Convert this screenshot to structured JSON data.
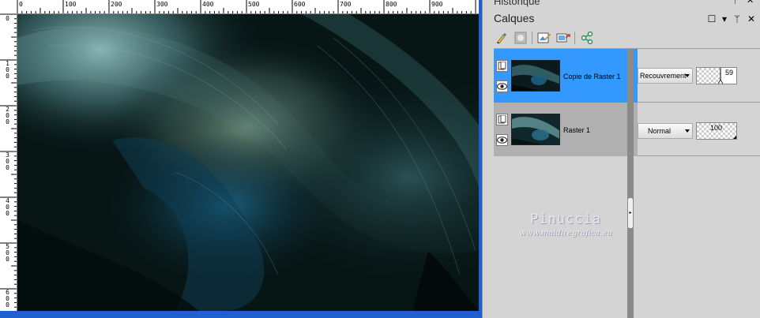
{
  "ruler": {
    "horizontal_labels": [
      "0",
      "100",
      "200",
      "300",
      "400",
      "500",
      "600",
      "700",
      "800",
      "900"
    ],
    "vertical_labels": [
      "0",
      "1\n0\n0",
      "2\n0\n0",
      "3\n0\n0",
      "4\n0\n0",
      "5\n0\n0",
      "6\n0\n0"
    ]
  },
  "history_panel": {
    "title": "Historique",
    "close_label": "✕",
    "pin_label": "ᛘ"
  },
  "layers_panel": {
    "title": "Calques",
    "controls": {
      "maximize": "☐",
      "menu": "▾",
      "pin": "ᛘ",
      "close": "✕"
    },
    "toolbar_icons": [
      "paint-brush-icon",
      "mask-icon",
      "layer-properties-icon",
      "link-layers-icon",
      "share-icon"
    ],
    "layers": [
      {
        "name": "Copie de Raster 1",
        "blend_mode": "Recouvrement",
        "opacity": "59",
        "selected": true
      },
      {
        "name": "Raster 1",
        "blend_mode": "Normal",
        "opacity": "100",
        "selected": false
      }
    ]
  },
  "watermark": {
    "name": "Pinuccia",
    "url": "www.maidiregrafica.eu"
  },
  "colors": {
    "selected_row": "#3399ff",
    "unselected_row": "#b0b0b0",
    "panel_bg": "#d4d4d4",
    "doc_scrollbar": "#1f5fd0"
  }
}
